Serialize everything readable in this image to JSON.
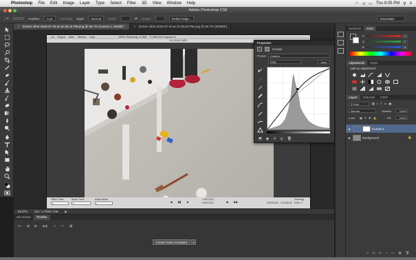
{
  "menubar": {
    "app_name": "Photoshop",
    "menus": [
      "File",
      "Edit",
      "Image",
      "Layer",
      "Type",
      "Select",
      "Filter",
      "3D",
      "View",
      "Window",
      "Help"
    ],
    "clock": "Thu 9:05 PM"
  },
  "window": {
    "title": "Adobe Photoshop CS6"
  },
  "options": {
    "feather_label": "Feather:",
    "feather_value": "0 px",
    "antialias_label": "Anti-alias",
    "style_label": "Style:",
    "style_value": "Normal",
    "width_label": "Width:",
    "height_label": "Height:",
    "refine_edge": "Refine Edge...",
    "workspace": "Essentials"
  },
  "doc_tabs": [
    {
      "label": "Screen Shot 2015-07-19 at 10.28.44 PM.png @ 66.7% (Curves 1, Red/8) *",
      "active": true
    },
    {
      "label": "Screen Shot 2015-07-19 at 10.28.53 PM.png @ 66.7% (RGB/8*)",
      "active": false
    }
  ],
  "quicktime": {
    "title": "MPEG Streamclip 1.9.3b8",
    "copyright": "© 2004-2012 Squared 5",
    "menus": [
      "Lin",
      "Dogma",
      "Altan",
      "Window",
      "Help"
    ],
    "filename": "EH_2015-2.MP4",
    "video_track_label": "Video Track",
    "audio_track_label": "Audio Track",
    "audio_mode_label": "Audio Mode",
    "video_track_value": "0",
    "audio_track_value": "0",
    "audio_mode_value": "1",
    "timecode": "1:00:13:22",
    "timecode_sub": "0:00:13:22",
    "in_time": "0:00:00.00",
    "out_time": "1:10:46.23",
    "zoom_label": "Zooming",
    "zoom_value": "0.64 / 2"
  },
  "properties": {
    "tab_label": "Properties",
    "heading": "Curves",
    "preset_label": "Preset:",
    "preset_value": "Custom",
    "channel_value": "RGB",
    "auto_button": "Auto"
  },
  "panels": {
    "swatches_tab": "Swatches",
    "color_tab": "Color",
    "color_rows": [
      {
        "label": "R",
        "value": "52",
        "color": "#d62a2a"
      },
      {
        "label": "G",
        "value": "57",
        "color": "#2fa84a"
      },
      {
        "label": "B",
        "value": "56",
        "color": "#2f5bd6"
      }
    ],
    "adjustments_tab": "Adjustments",
    "styles_tab": "Styles",
    "add_adjustment": "Add an adjustment",
    "layers_tab": "Layers",
    "channels_tab": "Channels",
    "paths_tab": "Paths",
    "kind_label": "Kind",
    "blend_mode": "Normal",
    "opacity_label": "Opacity:",
    "opacity_value": "100%",
    "lock_label": "Lock:",
    "fill_label": "Fill:",
    "fill_value": "100%",
    "layers": [
      {
        "name": "Curves 1",
        "selected": true
      },
      {
        "name": "Background",
        "selected": false
      }
    ]
  },
  "status": {
    "zoom": "66.67%",
    "doc_size": "Doc: 1.71M/1.71M"
  },
  "timeline": {
    "mini_bridge_tab": "Mini Bridge",
    "timeline_tab": "Timeline",
    "create_button": "Create Frame Animation"
  }
}
